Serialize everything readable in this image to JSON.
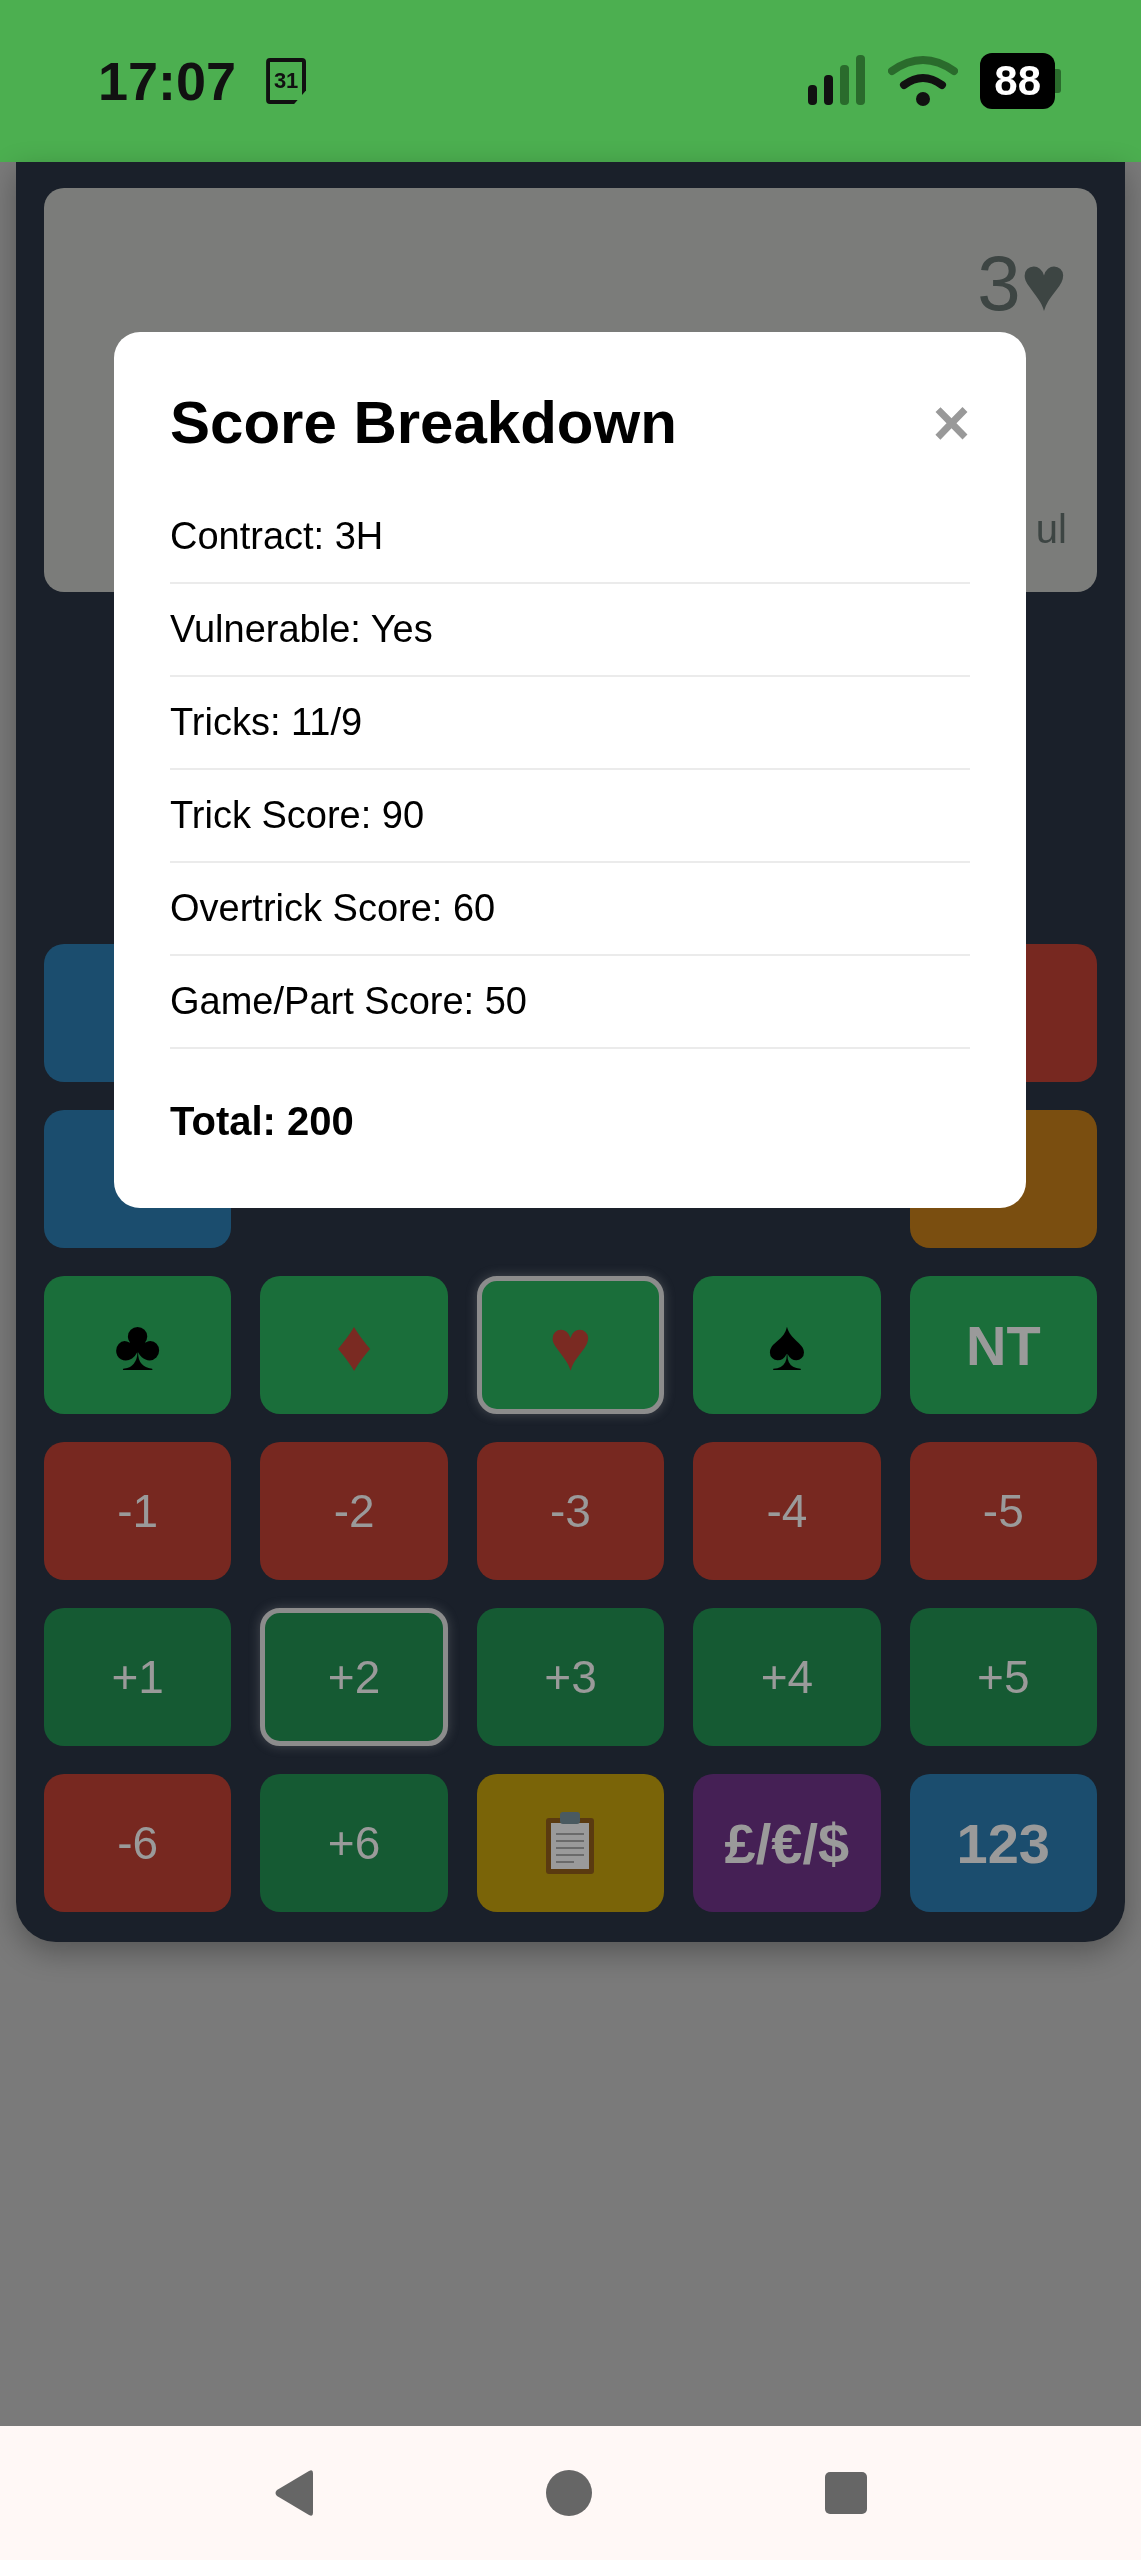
{
  "status_bar": {
    "time": "17:07",
    "calendar_day": "31",
    "battery": "88"
  },
  "display": {
    "contract": "3♥",
    "line_2": "ul"
  },
  "keypad": [
    [
      {
        "kind": "blank",
        "color": "#1b4d6e",
        "selected": false
      },
      {
        "kind": "blank",
        "color": "#772820",
        "selected": false
      }
    ],
    [
      {
        "kind": "blank",
        "color": "#1b4d6e",
        "selected": false
      },
      {
        "kind": "blank",
        "color": "#7a4e10",
        "selected": false
      }
    ],
    [
      {
        "kind": "black_suit",
        "label": "♣",
        "color": "#1a6e3a",
        "selected": false
      },
      {
        "kind": "red_suit",
        "label": "♦",
        "color": "#1a6e3a",
        "selected": false
      },
      {
        "kind": "red_suit",
        "label": "♥",
        "color": "#1a6e3a",
        "selected": true
      },
      {
        "kind": "black_suit",
        "label": "♠",
        "color": "#1a6e3a",
        "selected": false
      },
      {
        "kind": "bold",
        "label": "NT",
        "color": "#1a6e3a",
        "selected": false
      }
    ],
    [
      {
        "kind": "text",
        "label": "-1",
        "color": "#772820",
        "selected": false
      },
      {
        "kind": "text",
        "label": "-2",
        "color": "#772820",
        "selected": false
      },
      {
        "kind": "text",
        "label": "-3",
        "color": "#772820",
        "selected": false
      },
      {
        "kind": "text",
        "label": "-4",
        "color": "#772820",
        "selected": false
      },
      {
        "kind": "text",
        "label": "-5",
        "color": "#772820",
        "selected": false
      }
    ],
    [
      {
        "kind": "text",
        "label": "+1",
        "color": "#155a33",
        "selected": false
      },
      {
        "kind": "text",
        "label": "+2",
        "color": "#155a33",
        "selected": true
      },
      {
        "kind": "text",
        "label": "+3",
        "color": "#155a33",
        "selected": false
      },
      {
        "kind": "text",
        "label": "+4",
        "color": "#155a33",
        "selected": false
      },
      {
        "kind": "text",
        "label": "+5",
        "color": "#155a33",
        "selected": false
      }
    ],
    [
      {
        "kind": "text",
        "label": "-6",
        "color": "#772820",
        "selected": false
      },
      {
        "kind": "text",
        "label": "+6",
        "color": "#155a33",
        "selected": false
      },
      {
        "kind": "clipboard",
        "color": "#7a6408",
        "selected": false
      },
      {
        "kind": "bold",
        "label": "£/€/$",
        "color": "#452055",
        "selected": false
      },
      {
        "kind": "bold",
        "label": "123",
        "color": "#1b4d6e",
        "selected": false
      }
    ]
  ],
  "modal": {
    "title": "Score Breakdown",
    "close": "×",
    "lines": [
      "Contract: 3H",
      "Vulnerable: Yes",
      "Tricks: 11/9",
      "Trick Score: 90",
      "Overtrick Score: 60",
      "Game/Part Score: 50"
    ],
    "total": "Total: 200"
  }
}
